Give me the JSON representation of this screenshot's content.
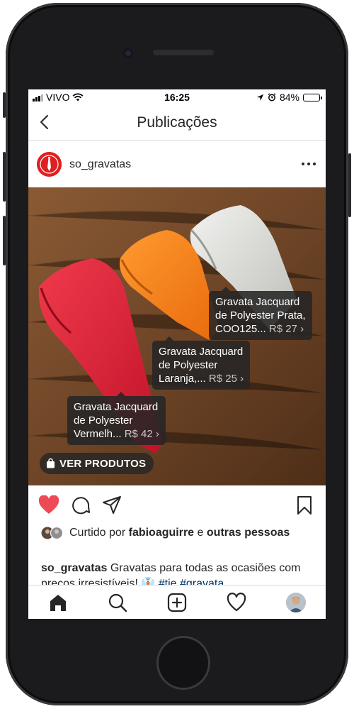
{
  "status_bar": {
    "carrier": "VIVO",
    "time": "16:25",
    "battery": "84%",
    "battery_level": 0.84
  },
  "header": {
    "title": "Publicações"
  },
  "post": {
    "username": "so_gravatas",
    "product_tags": [
      {
        "line1": "Gravata Jacquard",
        "line2": "de Polyester Prata,",
        "line3": "COO125...",
        "price": "R$ 27"
      },
      {
        "line1": "Gravata Jacquard",
        "line2": "de Polyester",
        "line3": "Laranja,...",
        "price": "R$ 25"
      },
      {
        "line1": "Gravata Jacquard",
        "line2": "de Polyester",
        "line3": "Vermelh...",
        "price": "R$ 42"
      }
    ],
    "shop_button": "VER PRODUTOS",
    "likes": {
      "prefix": "Curtido por",
      "user": "fabioaguirre",
      "connector": "e",
      "others": "outras pessoas"
    },
    "caption": {
      "username": "so_gravatas",
      "text": "Gravatas para todas as ocasiões com preços irresistíveis!",
      "hashtags": "#tie #gravata"
    }
  },
  "colors": {
    "like_red": "#ed4956",
    "avatar_red": "#e02020",
    "hashtag_blue": "#003569"
  }
}
